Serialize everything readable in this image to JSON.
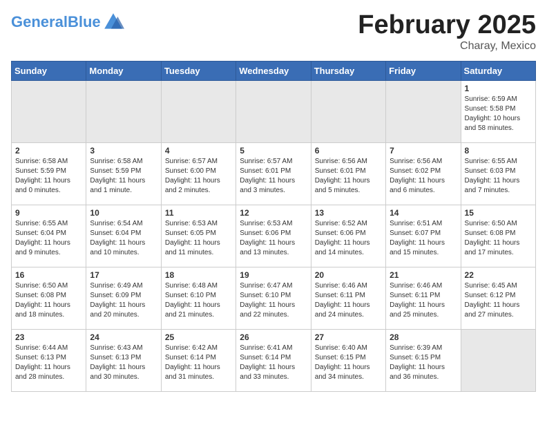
{
  "header": {
    "logo_general": "General",
    "logo_blue": "Blue",
    "month_year": "February 2025",
    "location": "Charay, Mexico"
  },
  "weekdays": [
    "Sunday",
    "Monday",
    "Tuesday",
    "Wednesday",
    "Thursday",
    "Friday",
    "Saturday"
  ],
  "weeks": [
    [
      {
        "day": "",
        "info": ""
      },
      {
        "day": "",
        "info": ""
      },
      {
        "day": "",
        "info": ""
      },
      {
        "day": "",
        "info": ""
      },
      {
        "day": "",
        "info": ""
      },
      {
        "day": "",
        "info": ""
      },
      {
        "day": "1",
        "info": "Sunrise: 6:59 AM\nSunset: 5:58 PM\nDaylight: 10 hours\nand 58 minutes."
      }
    ],
    [
      {
        "day": "2",
        "info": "Sunrise: 6:58 AM\nSunset: 5:59 PM\nDaylight: 11 hours\nand 0 minutes."
      },
      {
        "day": "3",
        "info": "Sunrise: 6:58 AM\nSunset: 5:59 PM\nDaylight: 11 hours\nand 1 minute."
      },
      {
        "day": "4",
        "info": "Sunrise: 6:57 AM\nSunset: 6:00 PM\nDaylight: 11 hours\nand 2 minutes."
      },
      {
        "day": "5",
        "info": "Sunrise: 6:57 AM\nSunset: 6:01 PM\nDaylight: 11 hours\nand 3 minutes."
      },
      {
        "day": "6",
        "info": "Sunrise: 6:56 AM\nSunset: 6:01 PM\nDaylight: 11 hours\nand 5 minutes."
      },
      {
        "day": "7",
        "info": "Sunrise: 6:56 AM\nSunset: 6:02 PM\nDaylight: 11 hours\nand 6 minutes."
      },
      {
        "day": "8",
        "info": "Sunrise: 6:55 AM\nSunset: 6:03 PM\nDaylight: 11 hours\nand 7 minutes."
      }
    ],
    [
      {
        "day": "9",
        "info": "Sunrise: 6:55 AM\nSunset: 6:04 PM\nDaylight: 11 hours\nand 9 minutes."
      },
      {
        "day": "10",
        "info": "Sunrise: 6:54 AM\nSunset: 6:04 PM\nDaylight: 11 hours\nand 10 minutes."
      },
      {
        "day": "11",
        "info": "Sunrise: 6:53 AM\nSunset: 6:05 PM\nDaylight: 11 hours\nand 11 minutes."
      },
      {
        "day": "12",
        "info": "Sunrise: 6:53 AM\nSunset: 6:06 PM\nDaylight: 11 hours\nand 13 minutes."
      },
      {
        "day": "13",
        "info": "Sunrise: 6:52 AM\nSunset: 6:06 PM\nDaylight: 11 hours\nand 14 minutes."
      },
      {
        "day": "14",
        "info": "Sunrise: 6:51 AM\nSunset: 6:07 PM\nDaylight: 11 hours\nand 15 minutes."
      },
      {
        "day": "15",
        "info": "Sunrise: 6:50 AM\nSunset: 6:08 PM\nDaylight: 11 hours\nand 17 minutes."
      }
    ],
    [
      {
        "day": "16",
        "info": "Sunrise: 6:50 AM\nSunset: 6:08 PM\nDaylight: 11 hours\nand 18 minutes."
      },
      {
        "day": "17",
        "info": "Sunrise: 6:49 AM\nSunset: 6:09 PM\nDaylight: 11 hours\nand 20 minutes."
      },
      {
        "day": "18",
        "info": "Sunrise: 6:48 AM\nSunset: 6:10 PM\nDaylight: 11 hours\nand 21 minutes."
      },
      {
        "day": "19",
        "info": "Sunrise: 6:47 AM\nSunset: 6:10 PM\nDaylight: 11 hours\nand 22 minutes."
      },
      {
        "day": "20",
        "info": "Sunrise: 6:46 AM\nSunset: 6:11 PM\nDaylight: 11 hours\nand 24 minutes."
      },
      {
        "day": "21",
        "info": "Sunrise: 6:46 AM\nSunset: 6:11 PM\nDaylight: 11 hours\nand 25 minutes."
      },
      {
        "day": "22",
        "info": "Sunrise: 6:45 AM\nSunset: 6:12 PM\nDaylight: 11 hours\nand 27 minutes."
      }
    ],
    [
      {
        "day": "23",
        "info": "Sunrise: 6:44 AM\nSunset: 6:13 PM\nDaylight: 11 hours\nand 28 minutes."
      },
      {
        "day": "24",
        "info": "Sunrise: 6:43 AM\nSunset: 6:13 PM\nDaylight: 11 hours\nand 30 minutes."
      },
      {
        "day": "25",
        "info": "Sunrise: 6:42 AM\nSunset: 6:14 PM\nDaylight: 11 hours\nand 31 minutes."
      },
      {
        "day": "26",
        "info": "Sunrise: 6:41 AM\nSunset: 6:14 PM\nDaylight: 11 hours\nand 33 minutes."
      },
      {
        "day": "27",
        "info": "Sunrise: 6:40 AM\nSunset: 6:15 PM\nDaylight: 11 hours\nand 34 minutes."
      },
      {
        "day": "28",
        "info": "Sunrise: 6:39 AM\nSunset: 6:15 PM\nDaylight: 11 hours\nand 36 minutes."
      },
      {
        "day": "",
        "info": ""
      }
    ]
  ]
}
